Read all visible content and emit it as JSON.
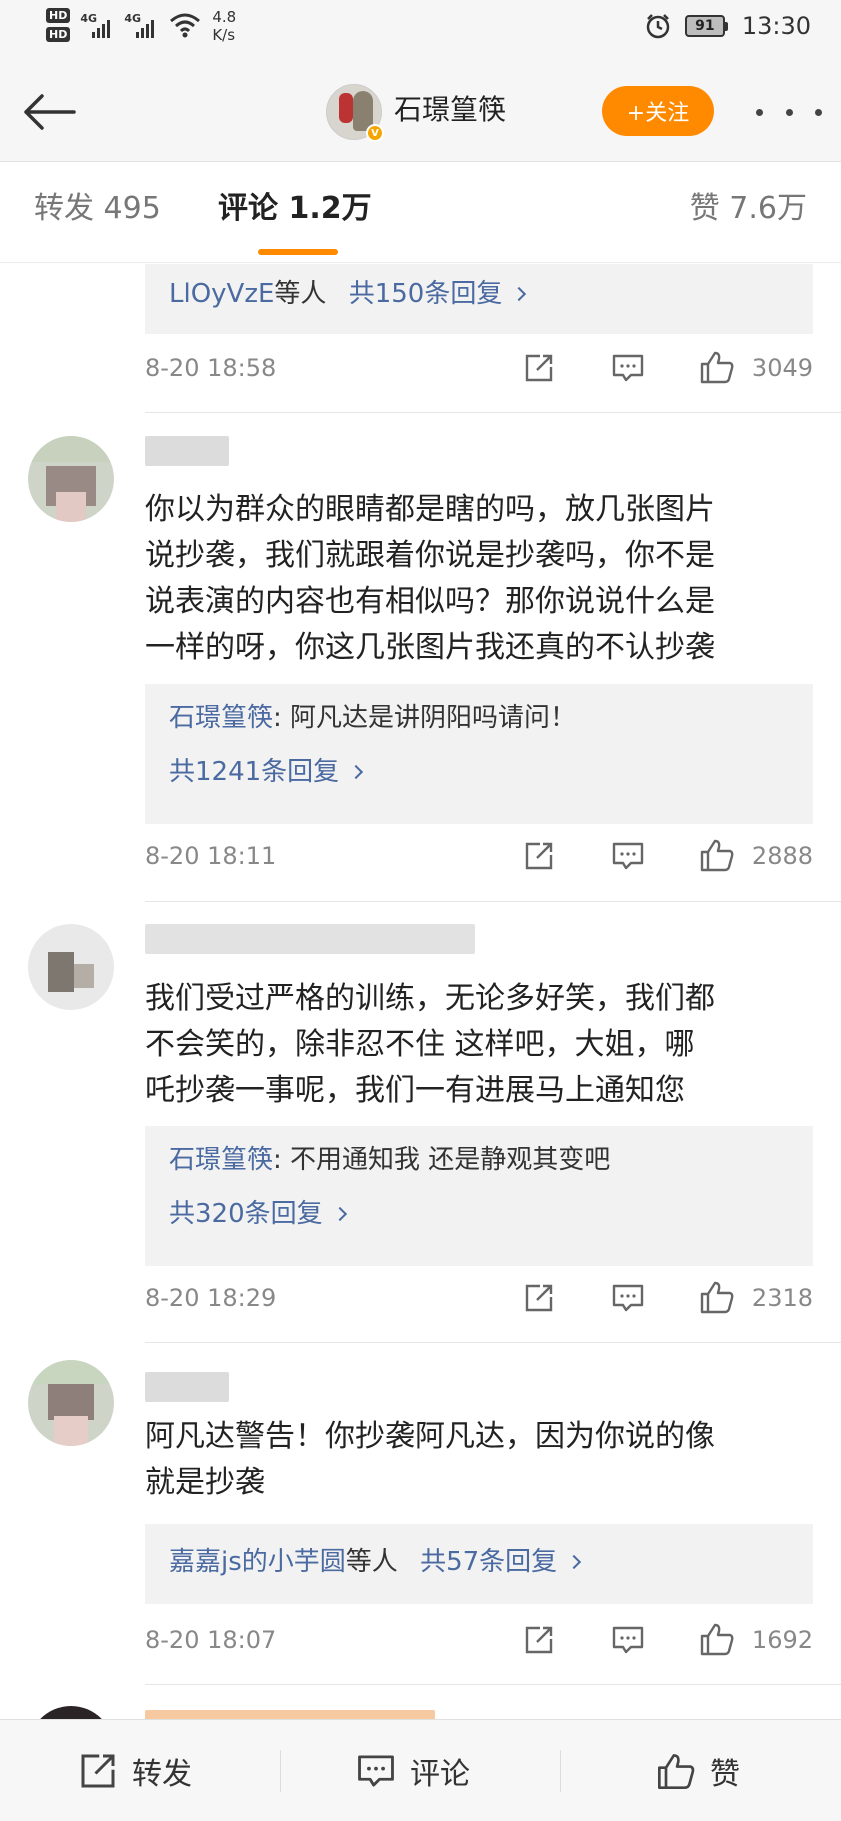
{
  "status_bar": {
    "hd1": "HD",
    "hd2": "HD",
    "net1": "4G",
    "net2": "4G",
    "speed_value": "4.8",
    "speed_unit": "K/s",
    "battery": "91",
    "time": "13:30"
  },
  "header": {
    "title": "石璟篁筷",
    "follow_label": "+关注"
  },
  "tabs": {
    "repost": "转发 495",
    "comment": "评论 1.2万",
    "like": "赞 7.6万"
  },
  "comments": [
    {
      "reply_users": "LlOyVzE",
      "reply_suffix": "等人",
      "reply_total": "共150条回复",
      "time": "8-20 18:58",
      "likes": "3049"
    },
    {
      "text_lines": [
        "你以为群众的眼睛都是瞎的吗，放几张图片",
        "说抄袭，我们就跟着你说是抄袭吗，你不是",
        "说表演的内容也有相似吗？那你说说什么是",
        "一样的呀，你这几张图片我还真的不认抄袭"
      ],
      "reply_author": "石璟篁筷",
      "reply_text": ": 阿凡达是讲阴阳吗请问！",
      "reply_total": "共1241条回复",
      "time": "8-20 18:11",
      "likes": "2888"
    },
    {
      "text_lines": [
        "我们受过严格的训练，无论多好笑，我们都",
        "不会笑的，除非忍不住 这样吧，大姐，哪",
        "吒抄袭一事呢，我们一有进展马上通知您"
      ],
      "reply_author": "石璟篁筷",
      "reply_text": ": 不用通知我 还是静观其变吧",
      "reply_total": "共320条回复",
      "time": "8-20 18:29",
      "likes": "2318"
    },
    {
      "text_lines": [
        "阿凡达警告！你抄袭阿凡达，因为你说的像",
        "就是抄袭"
      ],
      "reply_users": "嘉嘉js的小芋圆",
      "reply_suffix": "等人",
      "reply_total": "共57条回复",
      "time": "8-20 18:07",
      "likes": "1692"
    }
  ],
  "bottom_bar": {
    "repost": "转发",
    "comment": "评论",
    "like": "赞"
  },
  "colors": {
    "accent": "#ff8a00",
    "link": "#4a6aa1",
    "reply_bg": "#f2f2f2"
  }
}
